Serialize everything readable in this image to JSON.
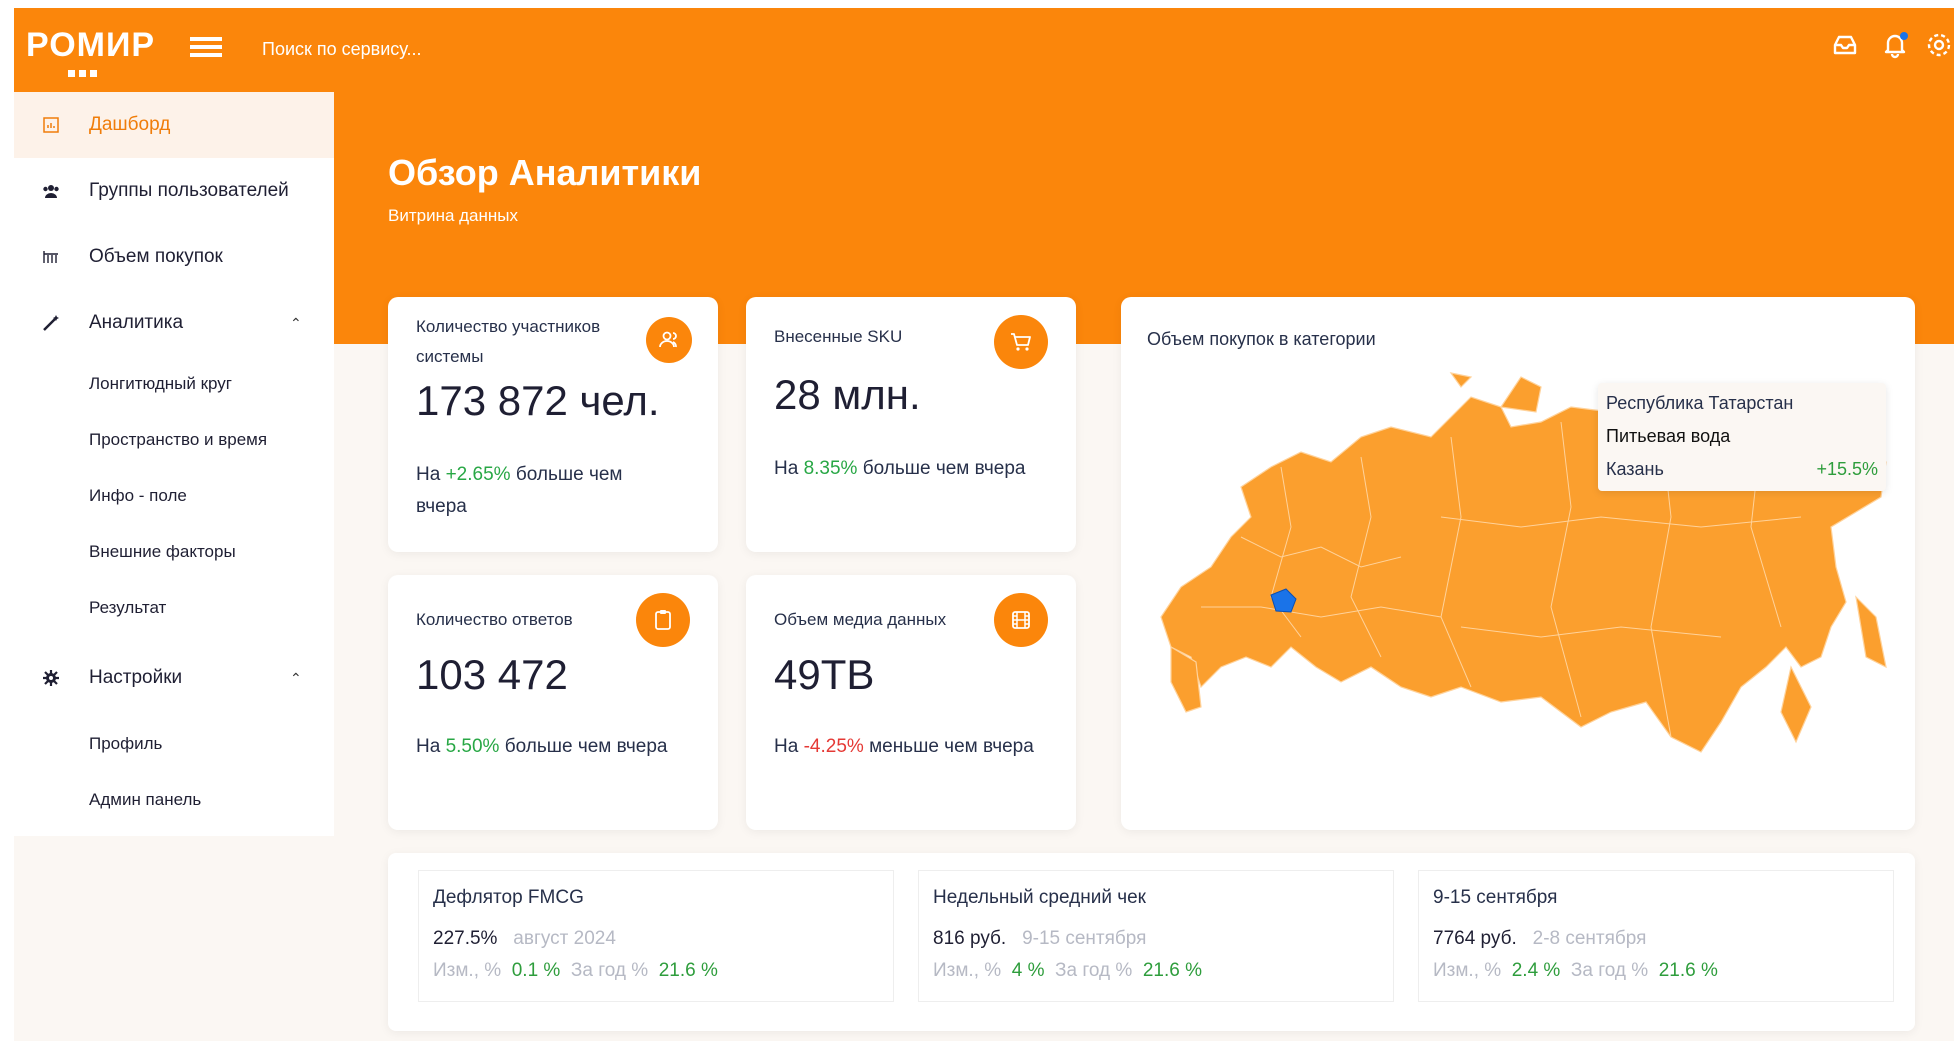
{
  "header": {
    "logo": "РОМИР",
    "search_placeholder": "Поиск по сервису..."
  },
  "sidebar": {
    "items": [
      {
        "label": "Дашборд",
        "icon": "chart-icon",
        "active": true
      },
      {
        "label": "Группы пользователей",
        "icon": "users-icon"
      },
      {
        "label": "Объем покупок",
        "icon": "bar-chart-icon"
      },
      {
        "label": "Аналитика",
        "icon": "magic-wand-icon",
        "expanded": true
      },
      {
        "label": "Настройки",
        "icon": "gear-icon",
        "expanded": true
      }
    ],
    "analytics_sub": [
      "Лонгитюдный круг",
      "Пространство и время",
      "Инфо - поле",
      "Внешние факторы",
      "Результат"
    ],
    "settings_sub": [
      "Профиль",
      "Админ панель"
    ]
  },
  "page": {
    "title": "Обзор Аналитики",
    "subtitle": "Витрина данных"
  },
  "kpis": [
    {
      "label": "Количество участников системы",
      "value": "173 872 чел.",
      "prefix": "На",
      "delta": "+2.65%",
      "suffix": "больше  чем вчера",
      "icon": "users-icon"
    },
    {
      "label": "Внесенные SKU",
      "value": "28 млн.",
      "prefix": "На",
      "delta": "8.35%",
      "suffix": "больше  чем вчера",
      "icon": "cart-icon"
    },
    {
      "label": "Количество ответов",
      "value": "103 472",
      "prefix": "На",
      "delta": "5.50%",
      "suffix": "больше  чем вчера",
      "icon": "clipboard-icon"
    },
    {
      "label": "Объем медиа данных",
      "value": "49TB",
      "prefix": "На",
      "delta": "-4.25%",
      "suffix": "меньше  чем вчера",
      "icon": "film-icon"
    }
  ],
  "map": {
    "title": "Объем покупок в категории",
    "fill_color": "#fb9f2e",
    "highlight_color": "#1a73e8",
    "tooltip": {
      "region": "Республика Татарстан",
      "category": "Питьевая вода",
      "city": "Казань",
      "change": "+15.5%"
    }
  },
  "indicators": [
    {
      "title": "Дефлятор FMCG",
      "value": "227.5%",
      "period": "август 2024",
      "chg_label": "Изм., %",
      "chg": "0.1 %",
      "year_label": "За год %",
      "year": "21.6 %"
    },
    {
      "title": "Недельный средний чек",
      "value": "816 руб.",
      "period": "9-15 сентября",
      "chg_label": "Изм., %",
      "chg": "4 %",
      "year_label": "За год %",
      "year": "21.6 %"
    },
    {
      "title": "9-15 сентября",
      "value": "7764 руб.",
      "period": "2-8 сентября",
      "chg_label": "Изм., %",
      "chg": "2.4 %",
      "year_label": "За год %",
      "year": "21.6 %"
    }
  ]
}
